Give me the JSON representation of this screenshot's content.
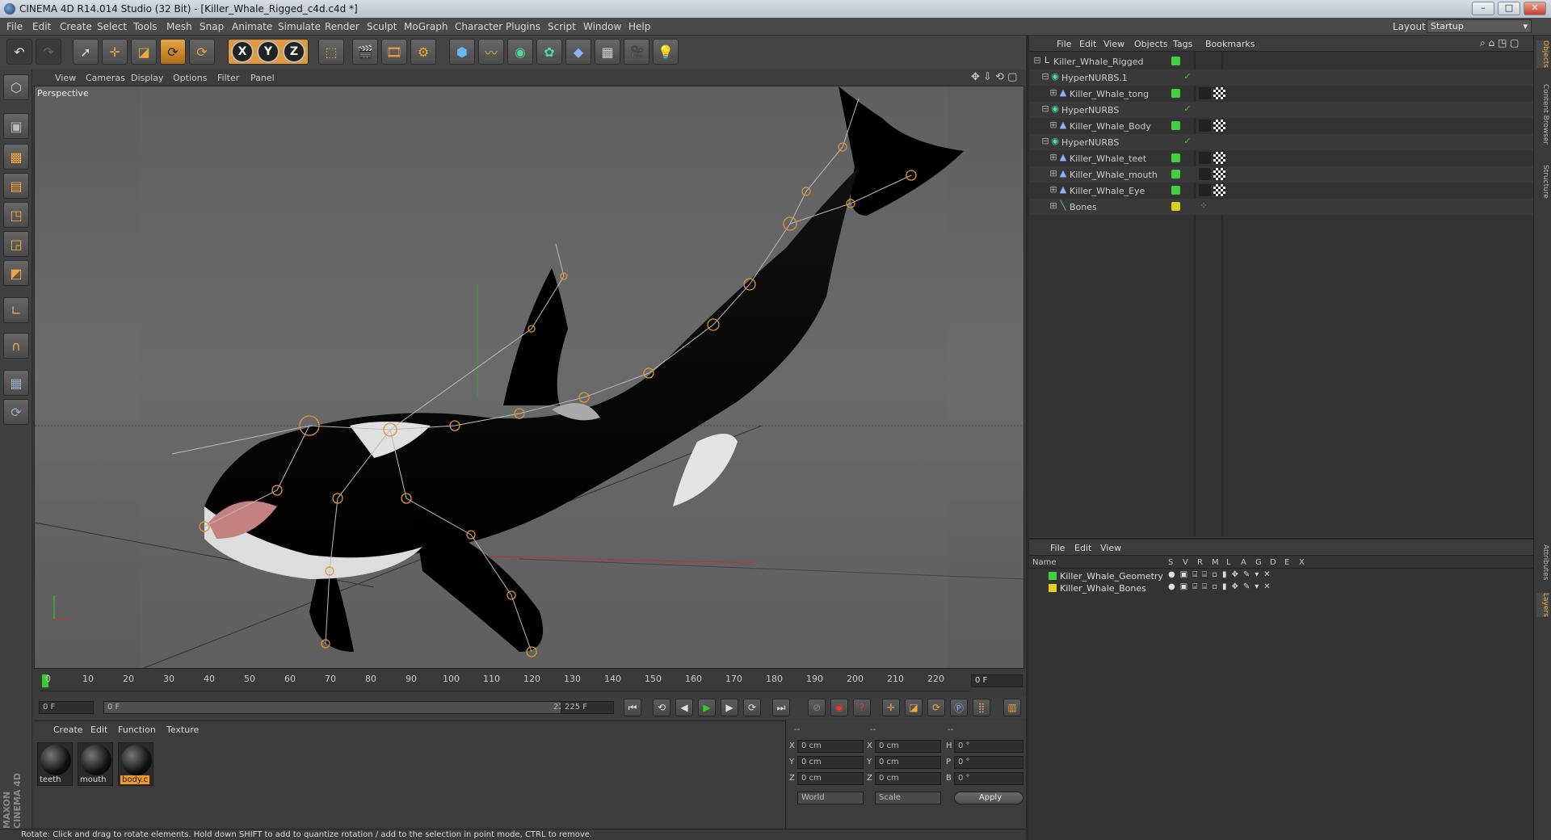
{
  "window": {
    "title": "CINEMA 4D R14.014 Studio (32 Bit) - [Killer_Whale_Rigged_c4d.c4d *]",
    "buttons": [
      "–",
      "□",
      "✕"
    ]
  },
  "menubar": {
    "items": [
      "File",
      "Edit",
      "Create",
      "Select",
      "Tools",
      "Mesh",
      "Snap",
      "Animate",
      "Simulate",
      "Render",
      "Sculpt",
      "MoGraph",
      "Character",
      "Plugins",
      "Script",
      "Window",
      "Help"
    ],
    "layout_label": "Layout:",
    "layout_value": "Startup"
  },
  "toolbar": {
    "icons": [
      "undo-icon",
      "redo-icon",
      "live-select-icon",
      "move-icon",
      "scale-icon",
      "rotate-icon",
      "recent-tool-icon",
      "x-axis-icon",
      "y-axis-icon",
      "z-axis-icon",
      "world-coords-icon",
      "render-view-icon",
      "render-picture-viewer-icon",
      "edit-render-settings-icon",
      "cube-icon",
      "spline-icon",
      "nurbs-icon",
      "array-icon",
      "deformer-icon",
      "floor-icon",
      "camera-icon",
      "light-icon"
    ],
    "axis_labels": [
      "X",
      "Y",
      "Z"
    ]
  },
  "viewport": {
    "menu": [
      "View",
      "Cameras",
      "Display",
      "Options",
      "Filter",
      "Panel"
    ],
    "label": "Perspective"
  },
  "timeline": {
    "ticks": [
      "0",
      "10",
      "20",
      "30",
      "40",
      "50",
      "60",
      "70",
      "80",
      "90",
      "100",
      "110",
      "120",
      "130",
      "140",
      "150",
      "160",
      "170",
      "180",
      "190",
      "200",
      "210",
      "220"
    ],
    "current_frame": "0 F",
    "start_field": "0 F",
    "range_start": "0 F",
    "range_end": "225 F",
    "end_field": "225 F"
  },
  "materials": {
    "menu": [
      "Create",
      "Edit",
      "Function",
      "Texture"
    ],
    "items": [
      {
        "name": "teeth",
        "selected": false
      },
      {
        "name": "mouth",
        "selected": false
      },
      {
        "name": "body.c",
        "selected": true
      }
    ]
  },
  "coordinates": {
    "header": [
      "--",
      "--",
      "--"
    ],
    "rows": [
      {
        "a": "X",
        "av": "0 cm",
        "b": "X",
        "bv": "0 cm",
        "c": "H",
        "cv": "0 °"
      },
      {
        "a": "Y",
        "av": "0 cm",
        "b": "Y",
        "bv": "0 cm",
        "c": "P",
        "cv": "0 °"
      },
      {
        "a": "Z",
        "av": "0 cm",
        "b": "Z",
        "bv": "0 cm",
        "c": "B",
        "cv": "0 °"
      }
    ],
    "mode1": "World",
    "mode2": "Scale",
    "apply": "Apply"
  },
  "status": "Rotate: Click and drag to rotate elements. Hold down SHIFT to add to quantize rotation / add to the selection in point mode, CTRL to remove.",
  "objects_panel": {
    "menu": [
      "File",
      "Edit",
      "View",
      "Objects",
      "Tags",
      "Bookmarks"
    ],
    "items": [
      {
        "name": "Killer_Whale_Rigged",
        "icon": "null-object-icon",
        "color": "#3fcf3f"
      },
      {
        "name": "HyperNURBS.1",
        "icon": "hypernurbs-icon",
        "color": "#3fcf3f"
      },
      {
        "name": "Killer_Whale_tong",
        "icon": "polygon-object-icon",
        "color": "#3fcf3f"
      },
      {
        "name": "HyperNURBS",
        "icon": "hypernurbs-icon",
        "color": "#3fcf3f"
      },
      {
        "name": "Killer_Whale_Body",
        "icon": "polygon-object-icon",
        "color": "#3fcf3f"
      },
      {
        "name": "HyperNURBS",
        "icon": "hypernurbs-icon",
        "color": "#3fcf3f"
      },
      {
        "name": "Killer_Whale_teet",
        "icon": "polygon-object-icon",
        "color": "#3fcf3f"
      },
      {
        "name": "Killer_Whale_mouth",
        "icon": "polygon-object-icon",
        "color": "#3fcf3f"
      },
      {
        "name": "Killer_Whale_Eye",
        "icon": "polygon-object-icon",
        "color": "#3fcf3f"
      },
      {
        "name": "Bones",
        "icon": "joint-icon",
        "color": "#d8d020"
      }
    ]
  },
  "layers_panel": {
    "menu": [
      "File",
      "Edit",
      "View"
    ],
    "name_header": "Name",
    "columns": [
      "S",
      "V",
      "R",
      "M",
      "L",
      "A",
      "G",
      "D",
      "E",
      "X"
    ],
    "layers": [
      {
        "name": "Killer_Whale_Geometry",
        "color": "#3fcf3f"
      },
      {
        "name": "Killer_Whale_Bones",
        "color": "#e0d020"
      }
    ]
  },
  "side_tabs": [
    "Objects",
    "Content Browser",
    "Structure",
    "Attributes",
    "Layers"
  ],
  "brand": "MAXON CINEMA 4D"
}
